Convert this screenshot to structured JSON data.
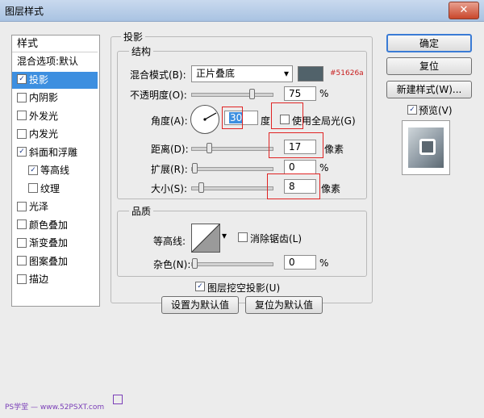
{
  "window": {
    "title": "图层样式",
    "close_label": "✕"
  },
  "style_list": {
    "header": "样式",
    "items": [
      {
        "label": "混合选项:默认",
        "checkbox": false,
        "checked": false
      },
      {
        "label": "投影",
        "checkbox": true,
        "checked": true,
        "selected": true
      },
      {
        "label": "内阴影",
        "checkbox": true,
        "checked": false
      },
      {
        "label": "外发光",
        "checkbox": true,
        "checked": false
      },
      {
        "label": "内发光",
        "checkbox": true,
        "checked": false
      },
      {
        "label": "斜面和浮雕",
        "checkbox": true,
        "checked": true
      },
      {
        "label": "等高线",
        "checkbox": true,
        "checked": true,
        "indent": true
      },
      {
        "label": "纹理",
        "checkbox": true,
        "checked": false,
        "indent": true
      },
      {
        "label": "光泽",
        "checkbox": true,
        "checked": false
      },
      {
        "label": "颜色叠加",
        "checkbox": true,
        "checked": false
      },
      {
        "label": "渐变叠加",
        "checkbox": true,
        "checked": false
      },
      {
        "label": "图案叠加",
        "checkbox": true,
        "checked": false
      },
      {
        "label": "描边",
        "checkbox": true,
        "checked": false
      }
    ]
  },
  "drop_shadow": {
    "section_title": "投影",
    "structure_title": "结构",
    "blend_mode_label": "混合模式(B):",
    "blend_mode_value": "正片叠底",
    "color_swatch": "#51626a",
    "color_note": "#51626a",
    "opacity_label": "不透明度(O):",
    "opacity_value": "75",
    "opacity_unit": "%",
    "opacity_level": 75,
    "angle_label": "角度(A):",
    "angle_value": "30",
    "angle_unit": "度",
    "global_light_label": "使用全局光(G)",
    "global_light_checked": false,
    "distance_label": "距离(D):",
    "distance_value": "17",
    "distance_unit": "像素",
    "spread_label": "扩展(R):",
    "spread_value": "0",
    "spread_unit": "%",
    "size_label": "大小(S):",
    "size_value": "8",
    "size_unit": "像素",
    "quality_title": "品质",
    "contour_label": "等高线:",
    "antialias_label": "消除锯齿(L)",
    "noise_label": "杂色(N):",
    "noise_value": "0",
    "noise_unit": "%",
    "knockout_label": "图层挖空投影(U)",
    "set_default_label": "设置为默认值",
    "reset_default_label": "复位为默认值"
  },
  "buttons": {
    "ok": "确定",
    "reset": "复位",
    "new_style": "新建样式(W)...",
    "preview_label": "预览(V)"
  },
  "watermark": "PS学堂 — www.52PSXT.com"
}
